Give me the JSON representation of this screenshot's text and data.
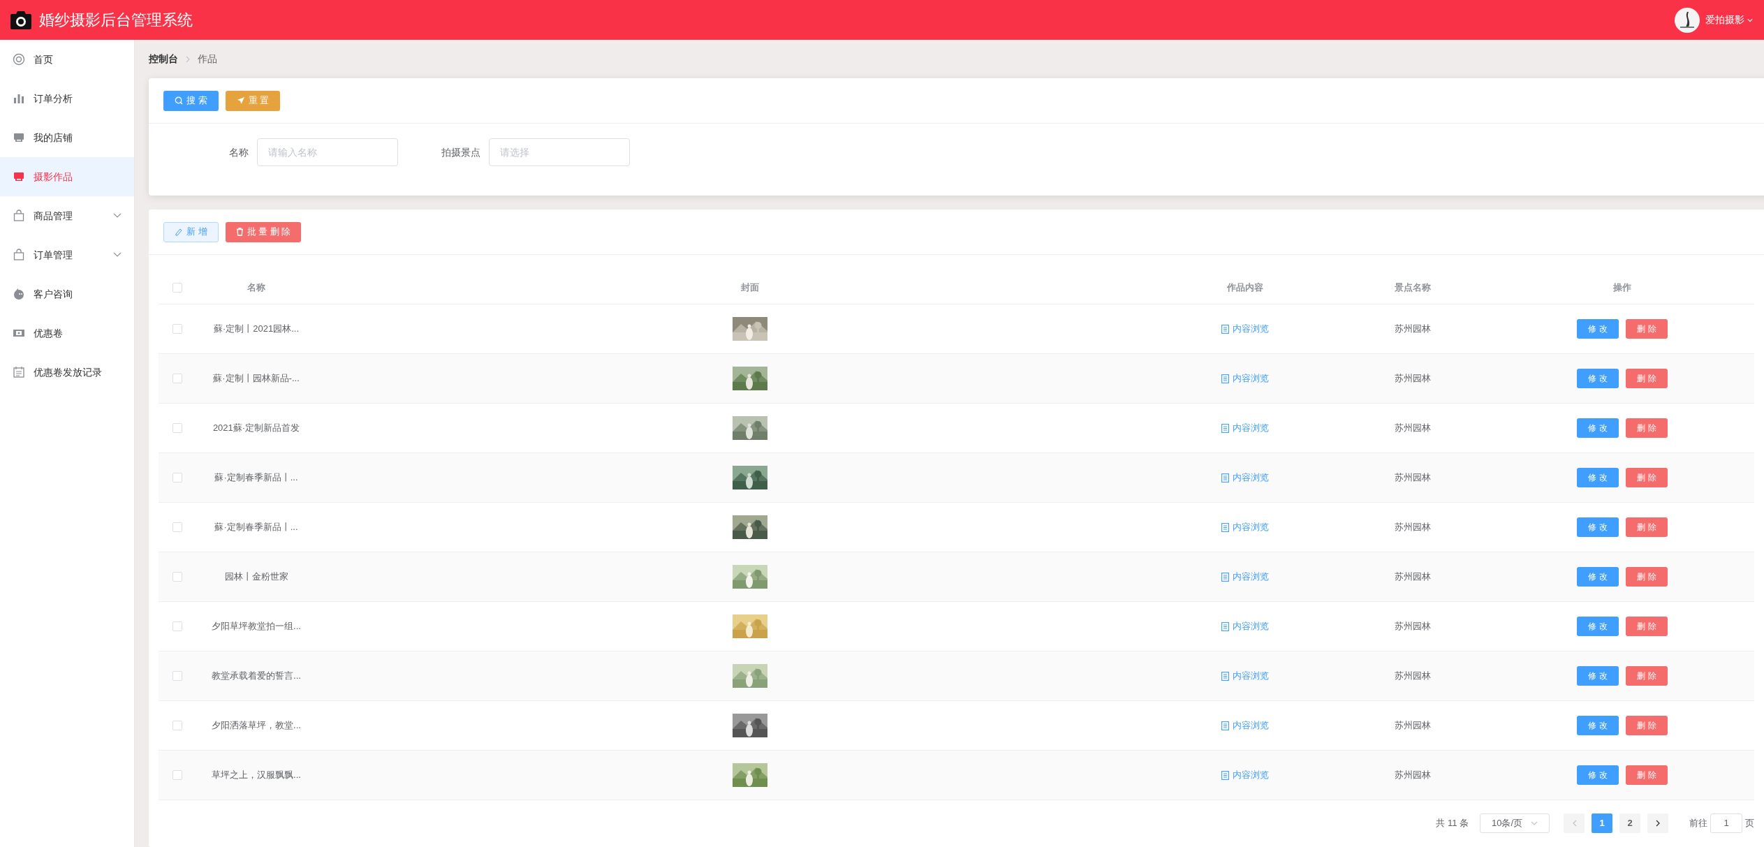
{
  "header": {
    "title": "婚纱摄影后台管理系统",
    "user": "爱拍摄影"
  },
  "sidebar": {
    "items": [
      {
        "label": "首页",
        "selected": false
      },
      {
        "label": "订单分析",
        "selected": false
      },
      {
        "label": "我的店铺",
        "selected": false
      },
      {
        "label": "摄影作品",
        "selected": true
      },
      {
        "label": "商品管理",
        "selected": false,
        "expanded": false
      },
      {
        "label": "订单管理",
        "selected": false,
        "expanded": false
      },
      {
        "label": "客户咨询",
        "selected": false
      },
      {
        "label": "优惠卷",
        "selected": false
      },
      {
        "label": "优惠卷发放记录",
        "selected": false
      }
    ]
  },
  "breadcrumb": [
    "控制台",
    "作品"
  ],
  "search_panel": {
    "buttons": [
      "搜 索",
      "重 置"
    ],
    "fields": [
      {
        "label": "名称",
        "placeholder": "请输入名称"
      },
      {
        "label": "拍摄景点",
        "placeholder": "请选择"
      }
    ]
  },
  "toolbar": {
    "buttons": [
      "新 增",
      "批 量 删 除"
    ]
  },
  "table": {
    "all_checked": false,
    "columns": [
      "名称",
      "封面",
      "作品内容",
      "景点名称",
      "操作"
    ],
    "rows": [
      {
        "checked": false,
        "name": "蘇·定制丨2021园林...",
        "content": "内容浏览",
        "scenic": "苏州园林",
        "actions": [
          "修 改",
          "删 除"
        ]
      },
      {
        "checked": false,
        "name": "蘇·定制丨园林新品-...",
        "content": "内容浏览",
        "scenic": "苏州园林",
        "actions": [
          "修 改",
          "删 除"
        ]
      },
      {
        "checked": false,
        "name": "2021蘇·定制新品首发",
        "content": "内容浏览",
        "scenic": "苏州园林",
        "actions": [
          "修 改",
          "删 除"
        ]
      },
      {
        "checked": false,
        "name": "蘇·定制春季新品丨...",
        "content": "内容浏览",
        "scenic": "苏州园林",
        "actions": [
          "修 改",
          "删 除"
        ]
      },
      {
        "checked": false,
        "name": "蘇·定制春季新品丨...",
        "content": "内容浏览",
        "scenic": "苏州园林",
        "actions": [
          "修 改",
          "删 除"
        ]
      },
      {
        "checked": false,
        "name": "园林丨金粉世家",
        "content": "内容浏览",
        "scenic": "苏州园林",
        "actions": [
          "修 改",
          "删 除"
        ]
      },
      {
        "checked": false,
        "name": "夕阳草坪教堂拍一组...",
        "content": "内容浏览",
        "scenic": "苏州园林",
        "actions": [
          "修 改",
          "删 除"
        ]
      },
      {
        "checked": false,
        "name": "教堂承载着爱的誓言...",
        "content": "内容浏览",
        "scenic": "苏州园林",
        "actions": [
          "修 改",
          "删 除"
        ]
      },
      {
        "checked": false,
        "name": "夕阳洒落草坪，教堂...",
        "content": "内容浏览",
        "scenic": "苏州园林",
        "actions": [
          "修 改",
          "删 除"
        ]
      },
      {
        "checked": false,
        "name": "草坪之上，汉服飘飘...",
        "content": "内容浏览",
        "scenic": "苏州园林",
        "actions": [
          "修 改",
          "删 除"
        ]
      }
    ]
  },
  "pagination": {
    "total": "共 11 条",
    "page_size": "10条/页",
    "prev_disabled": true,
    "pages": [
      {
        "label": "1",
        "selected": true
      },
      {
        "label": "2",
        "selected": false
      }
    ],
    "goto_label": "前往",
    "goto_value": "1",
    "goto_suffix": "页"
  }
}
